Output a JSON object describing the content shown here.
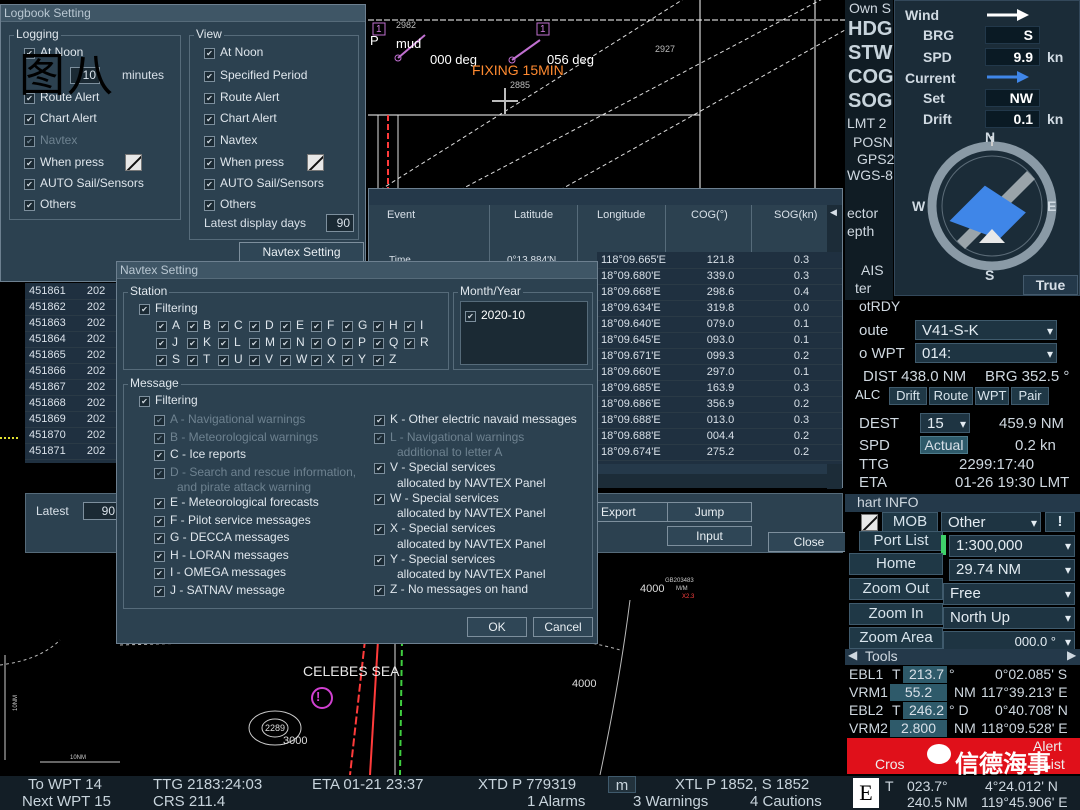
{
  "watermark": "图八",
  "chart": {
    "bearing_left": "000 deg",
    "bearing_right": "056 deg",
    "fixing": "FIXING 15MIN",
    "mud": "mud",
    "pt_2982": "2982",
    "pt_2885": "2885",
    "pt_2927": "2927",
    "pt_1a": "1",
    "pt_1b": "1",
    "letter_p": "P",
    "sea_name": "CELEBES SEA",
    "depth_4000a": "4000",
    "depth_4000b": "4000",
    "depth_3000": "3000",
    "depth_2289": "2289",
    "scale_10nm": "10NM",
    "scale_side": "10NM",
    "buoy_code": "GB203483",
    "buoy_mm": "M/M",
    "buoy_x": "X2.3",
    "danger": "!"
  },
  "logbook": {
    "title": "Logbook Setting",
    "logging_label": "Logging",
    "view_label": "View",
    "logging": [
      "At Noon",
      "10",
      "minutes",
      "Route Alert",
      "Chart Alert",
      "Navtex",
      "When press",
      "AUTO Sail/Sensors",
      "Others"
    ],
    "view": [
      "At Noon",
      "Specified Period",
      "Route Alert",
      "Chart Alert",
      "Navtex",
      "When press",
      "AUTO Sail/Sensors",
      "Others"
    ],
    "latest_days_label": "Latest display days",
    "latest_days_value": "90",
    "navtex_setting_btn": "Navtex Setting"
  },
  "log_table": {
    "headers": [
      "Event",
      "Latitude",
      "Longitude",
      "COG(°)",
      "SOG(kn)"
    ],
    "first_event": "Time",
    "first_lat": "0°13.884'N",
    "ids": [
      "451861",
      "451862",
      "451863",
      "451864",
      "451865",
      "451866",
      "451867",
      "451868",
      "451869",
      "451870",
      "451871"
    ],
    "year": "202",
    "longitudes": [
      "118°09.665'E",
      "18°09.680'E",
      "18°09.668'E",
      "18°09.634'E",
      "18°09.640'E",
      "18°09.645'E",
      "18°09.671'E",
      "18°09.660'E",
      "18°09.685'E",
      "18°09.686'E",
      "18°09.688'E",
      "18°09.688'E",
      "18°09.674'E"
    ],
    "cogs": [
      "121.8",
      "339.0",
      "298.6",
      "319.8",
      "079.0",
      "093.0",
      "099.3",
      "297.0",
      "163.9",
      "356.9",
      "013.0",
      "004.4",
      "275.2"
    ],
    "sogs": [
      "0.3",
      "0.3",
      "0.4",
      "0.0",
      "0.1",
      "0.1",
      "0.2",
      "0.1",
      "0.3",
      "0.2",
      "0.3",
      "0.2",
      "0.2"
    ],
    "latest_label": "Latest",
    "latest_value": "90",
    "export_btn": "Export",
    "jump_btn": "Jump",
    "input_btn": "Input",
    "close_btn": "Close"
  },
  "navtex": {
    "title": "Navtex Setting",
    "station_label": "Station",
    "filtering": "Filtering",
    "station_rows": [
      [
        "A",
        "B",
        "C",
        "D",
        "E",
        "F",
        "G",
        "H",
        "I"
      ],
      [
        "J",
        "K",
        "L",
        "M",
        "N",
        "O",
        "P",
        "Q",
        "R"
      ],
      [
        "S",
        "T",
        "U",
        "V",
        "W",
        "X",
        "Y",
        "Z"
      ]
    ],
    "month_label": "Month/Year",
    "month_value": "2020-10",
    "message_label": "Message",
    "msg_filtering": "Filtering",
    "messages_left": [
      {
        "l1": "A  - Navigational warnings",
        "l2": ""
      },
      {
        "l1": "B  - Meteorological warnings",
        "l2": ""
      },
      {
        "l1": "C  - Ice reports",
        "l2": ""
      },
      {
        "l1": "D  - Search and rescue information,",
        "l2": "and pirate attack warning"
      },
      {
        "l1": "E  - Meteorological forecasts",
        "l2": ""
      },
      {
        "l1": "F  - Pilot service messages",
        "l2": ""
      },
      {
        "l1": "G  - DECCA messages",
        "l2": ""
      },
      {
        "l1": "H  - LORAN messages",
        "l2": ""
      },
      {
        "l1": "I  - OMEGA messages",
        "l2": ""
      },
      {
        "l1": "J  - SATNAV message",
        "l2": ""
      }
    ],
    "messages_right": [
      {
        "l1": "K  - Other electric navaid messages",
        "l2": ""
      },
      {
        "l1": "L  - Navigational warnings",
        "l2": "additional to letter A"
      },
      {
        "l1": "V  - Special services",
        "l2": "allocated by NAVTEX Panel"
      },
      {
        "l1": "W  - Special services",
        "l2": "allocated by NAVTEX Panel"
      },
      {
        "l1": "X  - Special services",
        "l2": "allocated by NAVTEX Panel"
      },
      {
        "l1": "Y  - Special services",
        "l2": "allocated by NAVTEX Panel"
      },
      {
        "l1": "Z  - No messages on hand",
        "l2": ""
      }
    ],
    "ok": "OK",
    "cancel": "Cancel"
  },
  "side": {
    "own_s": "Own S",
    "hdg": "HDG",
    "stw": "STW",
    "cog": "COG",
    "sog": "SOG",
    "lmt": "LMT  2",
    "posn": "POSN",
    "gps": "GPS2",
    "wgs": "WGS-8",
    "ector": "ector",
    "epth": "epth",
    "ais": "AIS",
    "ter": "ter",
    "otrdy": "otRDY",
    "wind": "Wind",
    "brg_label": "BRG",
    "brg_val": "S",
    "spd_label": "SPD",
    "spd_val": "9.9",
    "spd_unit": "kn",
    "current": "Current",
    "set_label": "Set",
    "set_val": "NW",
    "drift_label": "Drift",
    "drift_val": "0.1",
    "drift_unit": "kn",
    "compass_n": "N",
    "compass_s": "S",
    "compass_e": "E",
    "compass_w": "W",
    "true_label": "True",
    "route_label": "oute",
    "route_val": "V41-S-K",
    "towpt_label": "o WPT",
    "towpt_val": "014:",
    "dist": "DIST 438.0 NM",
    "brg": "BRG 352.5 °",
    "tabs": [
      "ALC",
      "Drift",
      "Route",
      "WPT",
      "Pair"
    ],
    "dest_label": "DEST",
    "dest_val": "15",
    "dest_nm": "459.9 NM",
    "spd2_label": "SPD",
    "actual": "Actual",
    "spd2_val": "0.2 kn",
    "ttg_label": "TTG",
    "ttg_val": "2299:17:40",
    "eta_label": "ETA",
    "eta_val": "01-26 19:30 LMT",
    "chart_info": "hart INFO",
    "mob": "MOB",
    "other": "Other",
    "excl": "!",
    "port_list": "Port List",
    "scale": "1:300,000",
    "home": "Home",
    "range": "29.74 NM",
    "zoom_out": "Zoom Out",
    "free": "Free",
    "zoom_in": "Zoom In",
    "north_up": "North Up",
    "zoom_area": "Zoom Area",
    "bearing_000": "000.0 °",
    "tools": "Tools",
    "ebl1": "EBL1",
    "ebl1_t": "T",
    "ebl1_val": "213.7",
    "ebl1_deg": "°",
    "ebl1_pos": "0°02.085' S",
    "vrm1": "VRM1",
    "vrm1_val": "55.2",
    "vrm1_unit": "NM",
    "vrm1_pos": "117°39.213' E",
    "ebl2": "EBL2",
    "ebl2_t": "T",
    "ebl2_val": "246.2",
    "ebl2_deg": "° D",
    "ebl2_pos": "0°40.708' N",
    "vrm2": "VRM2",
    "vrm2_val": "2.800",
    "vrm2_unit": "NM",
    "vrm2_pos": "118°09.528' E",
    "alert": "Alert",
    "cross": "Cros",
    "list": "List",
    "wechat": "信德海事",
    "e_label": "E",
    "cur_t": "T",
    "cur_brg": "023.7°",
    "cur_rng": "240.5 NM",
    "cur_lat": "4°24.012' N",
    "cur_lon": "119°45.906' E"
  },
  "bottom": {
    "to_wpt": "To WPT 14",
    "ttg": "TTG 2183:24:03",
    "eta": "ETA 01-21 23:37",
    "xtd": "XTD P 779319",
    "m": "m",
    "xtl": "XTL P 1852, S 1852",
    "next_wpt": "Next WPT 15",
    "crs": "CRS 211.4",
    "alarms": "1 Alarms",
    "warnings": "3 Warnings",
    "cautions": "4 Cautions"
  }
}
